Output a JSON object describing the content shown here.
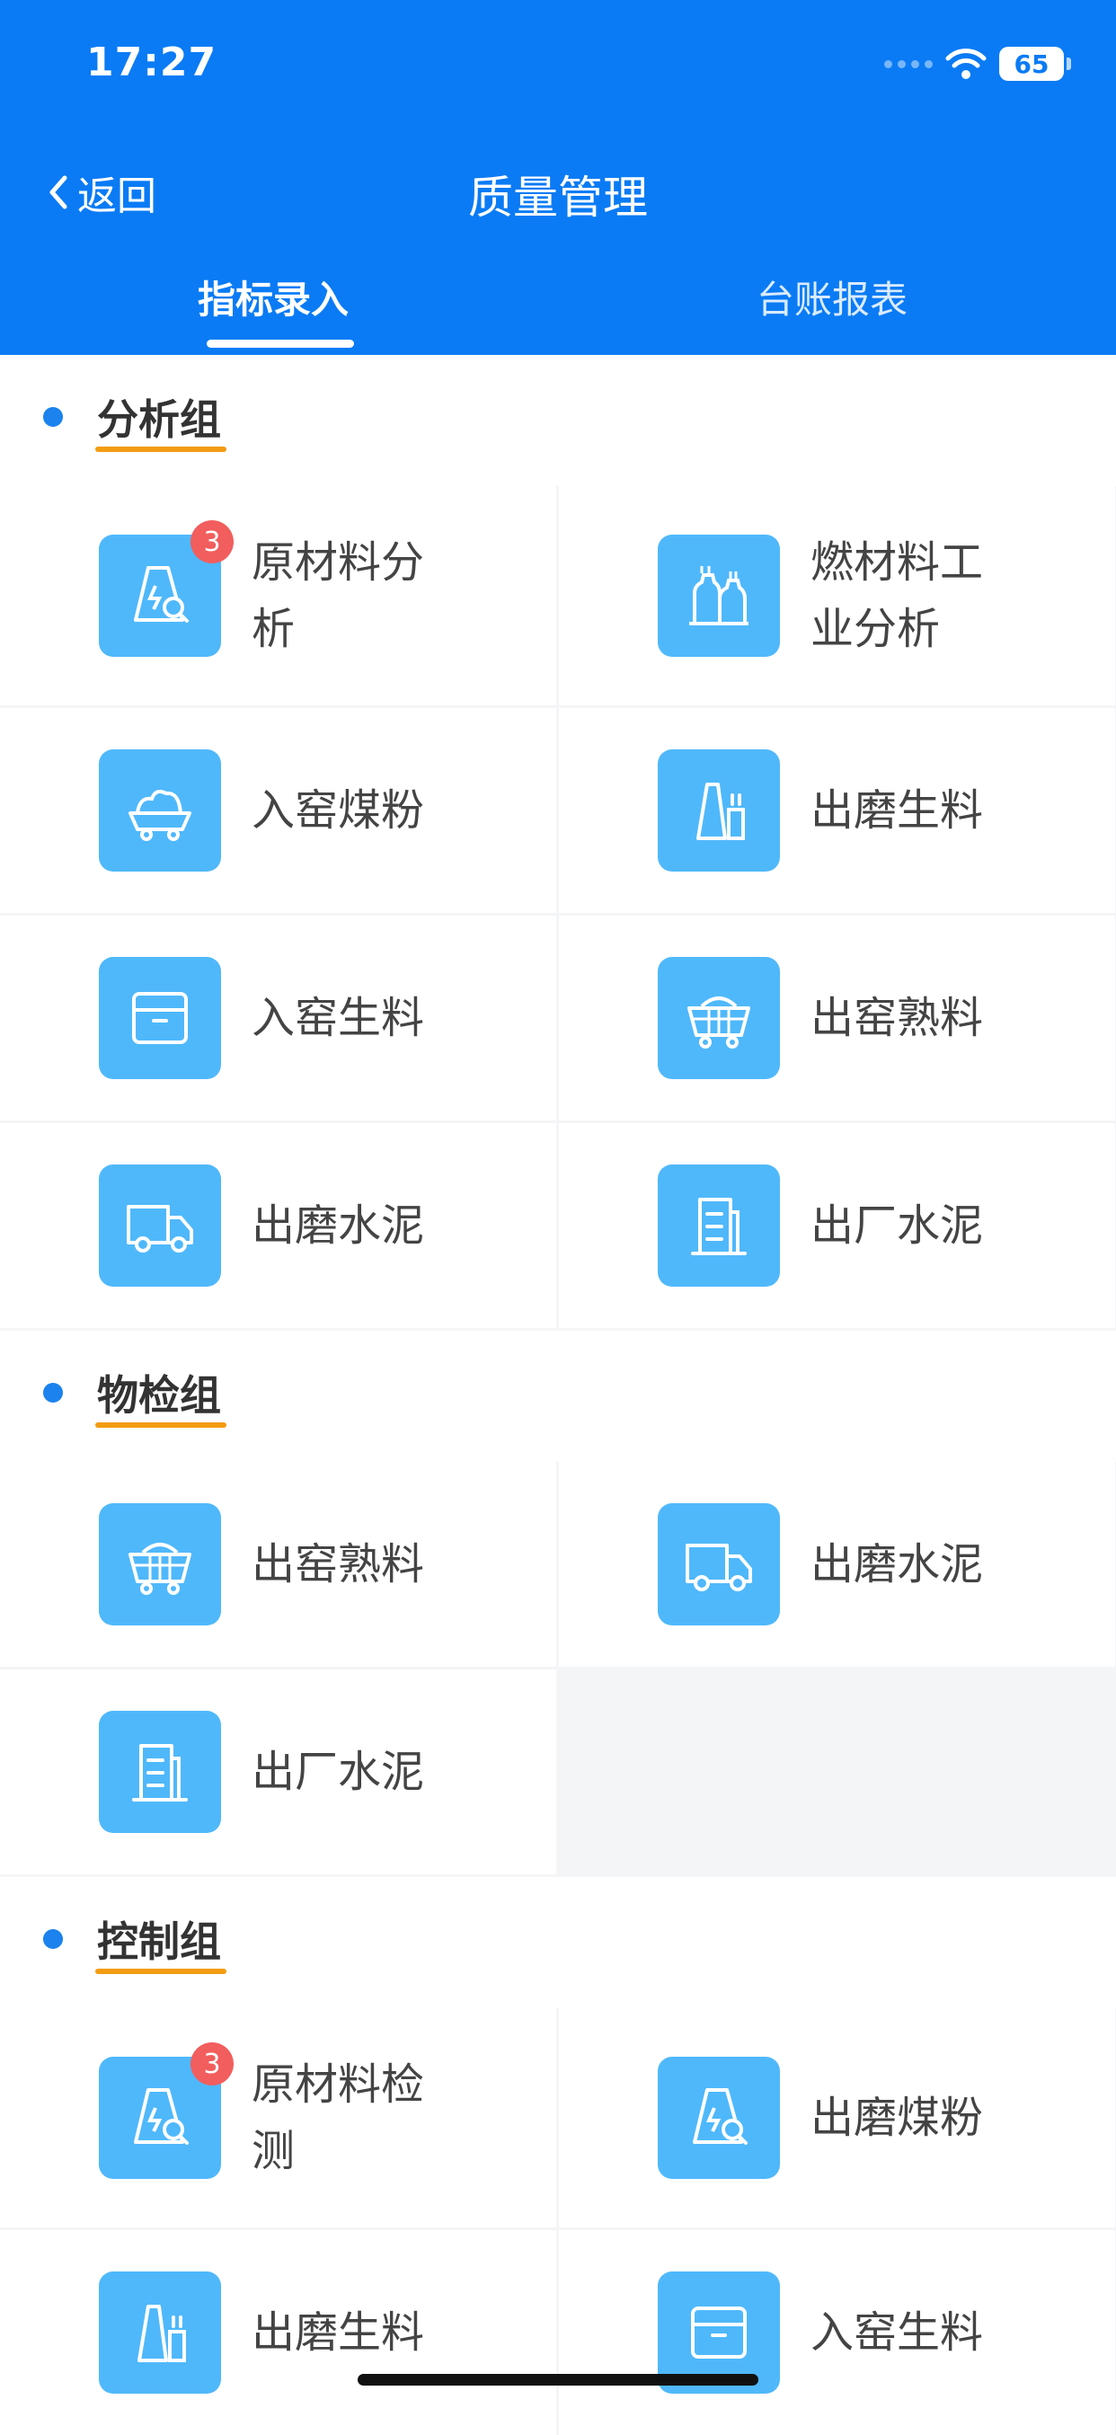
{
  "status": {
    "time": "17:27",
    "battery": "65"
  },
  "nav": {
    "back_label": "返回",
    "title": "质量管理"
  },
  "tabs": [
    {
      "label": "指标录入"
    },
    {
      "label": "台账报表"
    }
  ],
  "sections": [
    {
      "title": "分析组",
      "items": [
        {
          "label": "原材料分析",
          "icon": "flask-search-icon",
          "badge": "3"
        },
        {
          "label": "燃材料工业分析",
          "icon": "factory-chimney-icon"
        },
        {
          "label": "入窑煤粉",
          "icon": "coal-cart-icon"
        },
        {
          "label": "出磨生料",
          "icon": "mill-silo-icon"
        },
        {
          "label": "入窑生料",
          "icon": "box-icon"
        },
        {
          "label": "出窑熟料",
          "icon": "basket-cart-icon"
        },
        {
          "label": "出磨水泥",
          "icon": "truck-icon"
        },
        {
          "label": "出厂水泥",
          "icon": "building-icon"
        }
      ]
    },
    {
      "title": "物检组",
      "items": [
        {
          "label": "出窑熟料",
          "icon": "basket-cart-icon"
        },
        {
          "label": "出磨水泥",
          "icon": "truck-icon"
        },
        {
          "label": "出厂水泥",
          "icon": "building-icon"
        }
      ]
    },
    {
      "title": "控制组",
      "items": [
        {
          "label": "原材料检测",
          "icon": "flask-search-icon",
          "badge": "3"
        },
        {
          "label": "出磨煤粉",
          "icon": "flask-search-icon"
        },
        {
          "label": "出磨生料",
          "icon": "mill-silo-icon"
        },
        {
          "label": "入窑生料",
          "icon": "box-icon"
        }
      ]
    }
  ]
}
